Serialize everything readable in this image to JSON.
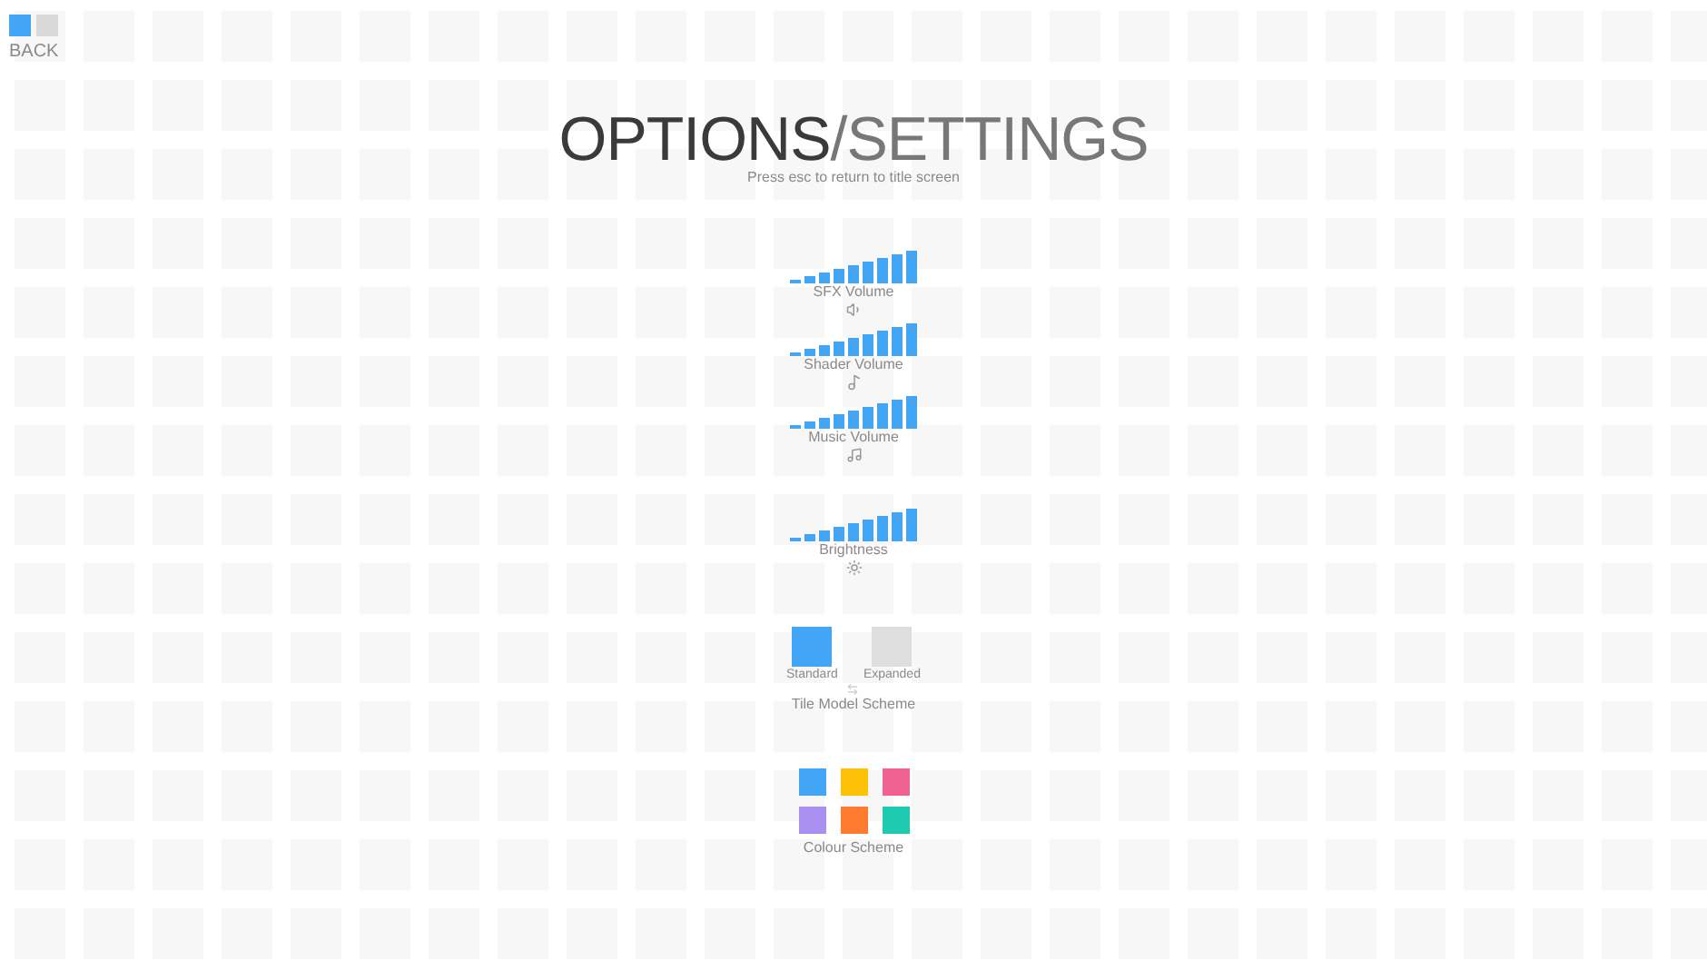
{
  "back": {
    "label": "BACK",
    "squares": [
      {
        "color": "#42a5f5"
      },
      {
        "color": "#d9d9d9"
      }
    ]
  },
  "title": {
    "main": "OPTIONS",
    "sub": "/SETTINGS"
  },
  "hint": "Press esc to return to title screen",
  "sliders": [
    {
      "label": "SFX Volume"
    },
    {
      "label": "Shader Volume"
    },
    {
      "label": "Music Volume"
    },
    {
      "label": "Brightness"
    }
  ],
  "mode": {
    "label": "Tile Model Scheme",
    "options": [
      {
        "label": "Standard",
        "selected": true
      },
      {
        "label": "Expanded",
        "selected": false
      }
    ]
  },
  "colours": {
    "label": "Colour Scheme",
    "swatches": [
      {
        "color": "#42a5f5"
      },
      {
        "color": "#ffc107"
      },
      {
        "color": "#f06292"
      },
      {
        "color": "#a98ff0"
      },
      {
        "color": "#ff7b30"
      },
      {
        "color": "#1ecbb0"
      }
    ]
  }
}
